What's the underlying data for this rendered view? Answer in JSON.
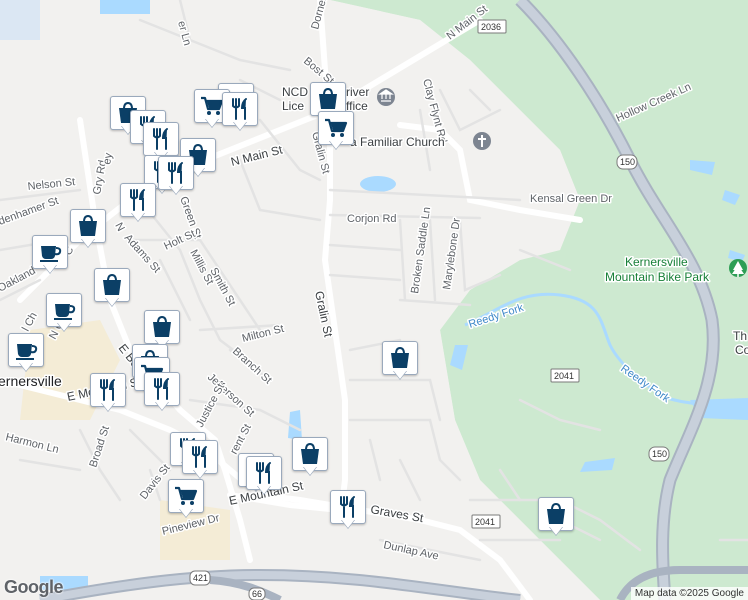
{
  "map": {
    "attribution": "Map data ©2025 Google",
    "logo": "Google",
    "streets": {
      "n_main_st_upper": "N Main St",
      "n_main_st_left": "N Main St",
      "dorner": "Dorner",
      "bost_st": "Bost St",
      "gralin_st_upper": "Gralin St",
      "gralin_st_lower": "Gralin St",
      "clay_flynt_rd": "Clay Flynt Rd",
      "corjon_rd": "Corjon Rd",
      "kensal_green_dr": "Kensal Green Dr",
      "broken_saddle_ln": "Broken Saddle Ln",
      "marylebone_dr": "Marylebone Dr",
      "hollow_creek_ln": "Hollow Creek Ln",
      "nelson_st": "Nelson St",
      "denhamer_st": "denhamer St",
      "gry_rd": "Gry Rd",
      "green_st": "Green St",
      "holt_st": "Holt St",
      "millis_st": "Millis St",
      "smith_st": "Smith St",
      "adams_st": "Adams St",
      "oakland": "Oakland",
      "milton_st": "Milton St",
      "branch_st": "Branch St",
      "jefferson_st": "Jefferson St",
      "e_mountain_st_left": "E Mountain St",
      "e_mountain_st_lower": "E Mountain St",
      "harmon_ln": "Harmon Ln",
      "broad_st": "Broad St",
      "davis_st": "Davis St",
      "pineview_dr": "Pineview Dr",
      "graves_st": "Graves St",
      "dunlap_ave": "Dunlap Ave",
      "justice_st": "Justice St",
      "brent_st": "rent St",
      "e_bo": "E Bo",
      "ker_ln": "er Ln",
      "n_ch": "N Ch",
      "n_left": "N",
      "c_left": "C",
      "ey": "ey",
      "l_ch": "l Ch"
    },
    "places": {
      "city": "ernersville",
      "church": "a Familiar Church",
      "dmv": "NCD     river\nLice      ffice",
      "dmv_line1": "NCD",
      "dmv_line1b": "river",
      "dmv_line2": "Lice",
      "dmv_line2b": "ffice",
      "park_line1": "Kernersville",
      "park_line2": "Mountain Bike Park",
      "creek_upper": "Reedy Fork",
      "creek_lower": "Reedy Fork",
      "edge_th": "Th",
      "edge_co": "Co"
    },
    "shields": {
      "s2036": "2036",
      "s150_upper": "150",
      "s150_lower": "150",
      "s2041_right": "2041",
      "s2041_lower": "2041",
      "s421": "421",
      "s66": "66"
    },
    "pin_icons": {
      "shopping_cart": "shopping-cart-icon",
      "restaurant": "fork-knife-icon",
      "shopping_bag": "shopping-bag-icon",
      "coffee": "coffee-cup-icon"
    },
    "colors": {
      "background": "#f2f1ef",
      "park": "#cde9d0",
      "water": "#aadaff",
      "road": "#ffffff",
      "highway": "#a9b3c1",
      "pin_icon": "#0b3f66"
    }
  }
}
